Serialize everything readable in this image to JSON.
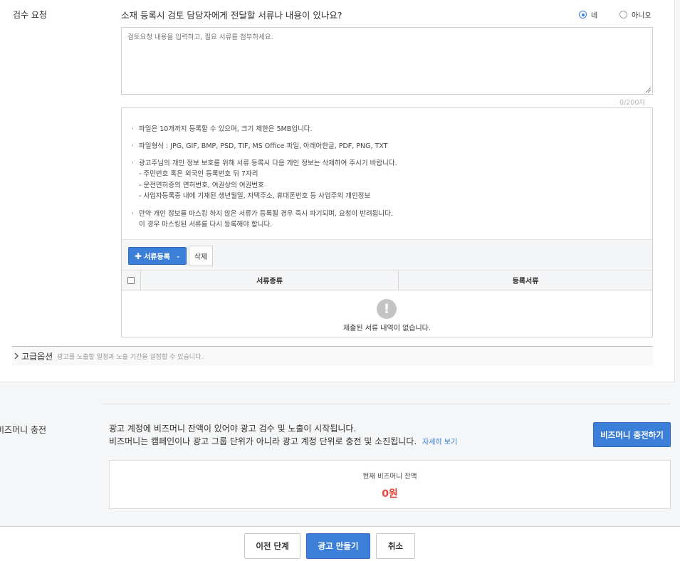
{
  "review": {
    "section_label": "검수 요청",
    "question": "소재 등록시 검토 담당자에게 전달할 서류나 내용이 있나요?",
    "options": [
      {
        "label": "네",
        "selected": true
      },
      {
        "label": "아니오",
        "selected": false
      }
    ],
    "textarea_placeholder": "검토요청 내용을 입력하고, 필요 서류를 첨부하세요.",
    "counter": "0/200자"
  },
  "upload": {
    "notices": [
      {
        "lines": [
          "파일은 10개까지 등록할 수 있으며, 크기 제한은 5MB입니다."
        ]
      },
      {
        "lines": [
          "파일형식 : JPG, GIF, BMP, PSD, TIF, MS Office 파일, 아래아한글, PDF, PNG, TXT"
        ]
      },
      {
        "lines": [
          "광고주님의 개인 정보 보호를 위해 서류 등록시 다음 개인 정보는 삭제하여 주시기 바랍니다.",
          "- 주민번호 혹은 외국인 등록번호 뒤 7자리",
          "- 운전면허증의 면허번호, 여권상의 여권번호",
          "- 사업자등록증 내에 기재된 생년월일, 자택주소, 휴대폰번호 등 사업주의 개인정보"
        ]
      },
      {
        "lines": [
          "만약 개인 정보를 마스킹 하지 않은 서류가 등록될 경우 즉시 파기되며, 요청이 반려됩니다.",
          "이 경우 마스킹된 서류를 다시 등록해야 합니다."
        ]
      }
    ],
    "register_button": "서류등록",
    "delete_button": "삭제",
    "columns": [
      "서류종류",
      "등록서류"
    ],
    "empty_icon": "!",
    "empty_message": "제출된 서류 내역이 없습니다."
  },
  "advanced": {
    "title": "고급옵션",
    "description": "광고를 노출할 일정과 노출 기간을 설정할 수 있습니다."
  },
  "bizmoney": {
    "label": "비즈머니 충전",
    "desc_line1": "광고 계정에 비즈머니 잔액이 있어야 광고 검수 및 노출이 시작됩니다.",
    "desc_line2": "비즈머니는 캠페인이나 광고 그룹 단위가 아니라 광고 계정 단위로 충전 및 소진됩니다.",
    "detail_link": "자세히 보기",
    "charge_button": "비즈머니 충전하기",
    "balance_label": "현재 비즈머니 잔액",
    "balance_value": "0원"
  },
  "footer": {
    "prev_button": "이전 단계",
    "create_button": "광고 만들기",
    "cancel_button": "취소"
  },
  "colors": {
    "primary": "#3b7fd9",
    "balance": "#e8423c",
    "link": "#2f7ad6"
  }
}
